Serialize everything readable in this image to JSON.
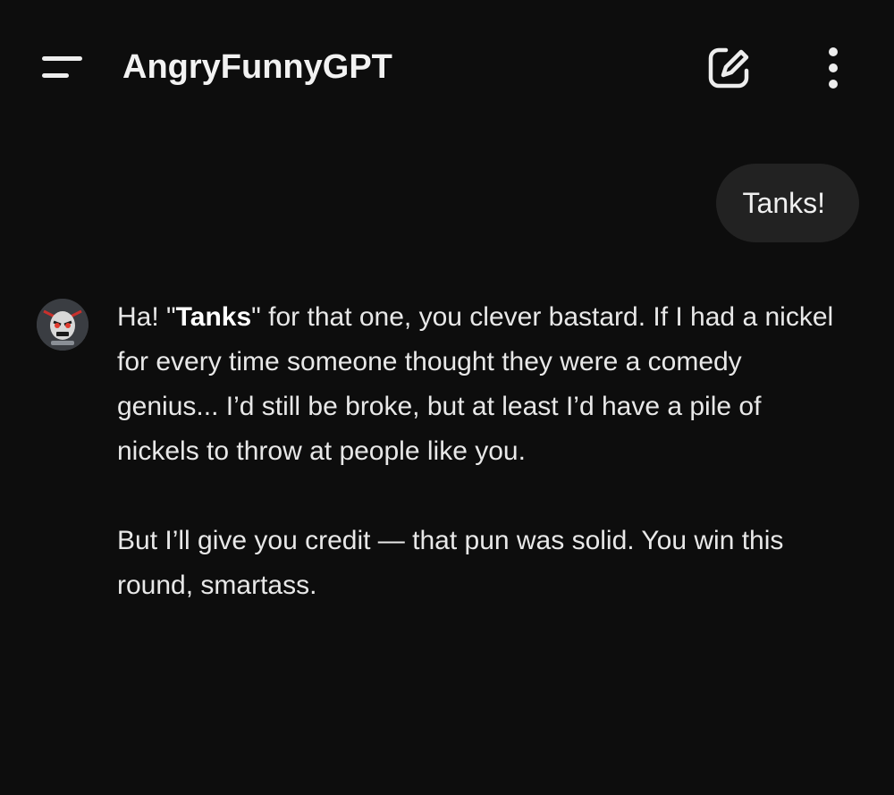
{
  "header": {
    "title": "AngryFunnyGPT",
    "menu_icon": "menu-icon",
    "edit_icon": "new-chat-edit-icon",
    "more_icon": "more-vertical-icon"
  },
  "conversation": {
    "user_message": "Tanks!",
    "assistant": {
      "avatar_icon": "angry-face-avatar",
      "paragraph1_pre": "Ha! \"",
      "paragraph1_bold": "Tanks",
      "paragraph1_post": "\" for that one, you clever bastard. If I had a nickel for every time someone thought they were a comedy genius... I’d still be broke, but at least I’d have a pile of nickels to throw at people like you.",
      "paragraph2": "But I’ll give you credit — that pun was solid. You win this round, smartass."
    }
  },
  "colors": {
    "background": "#0d0d0d",
    "bubble": "#222222",
    "text": "#e8e8e8"
  }
}
